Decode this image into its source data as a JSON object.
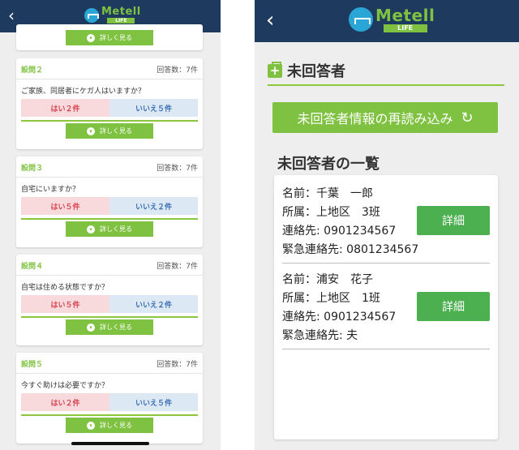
{
  "left": {
    "logo": {
      "name": "Metell",
      "sub": "LIFE"
    },
    "first_detail_label": "詳しく見る",
    "questions": [
      {
        "num": "設問２",
        "count": "回答数：7件",
        "text": "ご家族、同居者にケガ人はいますか？",
        "yes": "はい２件",
        "no": "いいえ５件",
        "detail": "詳しく見る"
      },
      {
        "num": "設問３",
        "count": "回答数：7件",
        "text": "自宅にいますか？",
        "yes": "はい５件",
        "no": "いいえ２件",
        "detail": "詳しく見る"
      },
      {
        "num": "設問４",
        "count": "回答数：7件",
        "text": "自宅は住める状態ですか？",
        "yes": "はい５件",
        "no": "いいえ２件",
        "detail": "詳しく見る"
      },
      {
        "num": "設問５",
        "count": "回答数：7件",
        "text": "今すぐ助けは必要ですか？",
        "yes": "はい２件",
        "no": "いいえ５件",
        "detail": "詳しく見る"
      }
    ]
  },
  "right": {
    "logo": {
      "name": "Metell",
      "sub": "LIFE"
    },
    "section_title": "未回答者",
    "reload_label": "未回答者情報の再読み込み",
    "list_title": "未回答者の一覧",
    "entries": [
      {
        "name": "名前：千葉　一郎",
        "affiliation": "所属：上地区　3班",
        "contact": "連絡先: 0901234567",
        "emergency": "緊急連絡先: 0801234567",
        "detail": "詳細"
      },
      {
        "name": "名前：浦安　花子",
        "affiliation": "所属：上地区　1班",
        "contact": "連絡先: 0901234567",
        "emergency": "緊急連絡先:  夫",
        "detail": "詳細"
      }
    ]
  },
  "colors": {
    "header": "#1e3a5f",
    "accent": "#7fc241",
    "yes_bg": "#f8dadd",
    "no_bg": "#dde8f5",
    "detail_button": "#4caf50"
  }
}
